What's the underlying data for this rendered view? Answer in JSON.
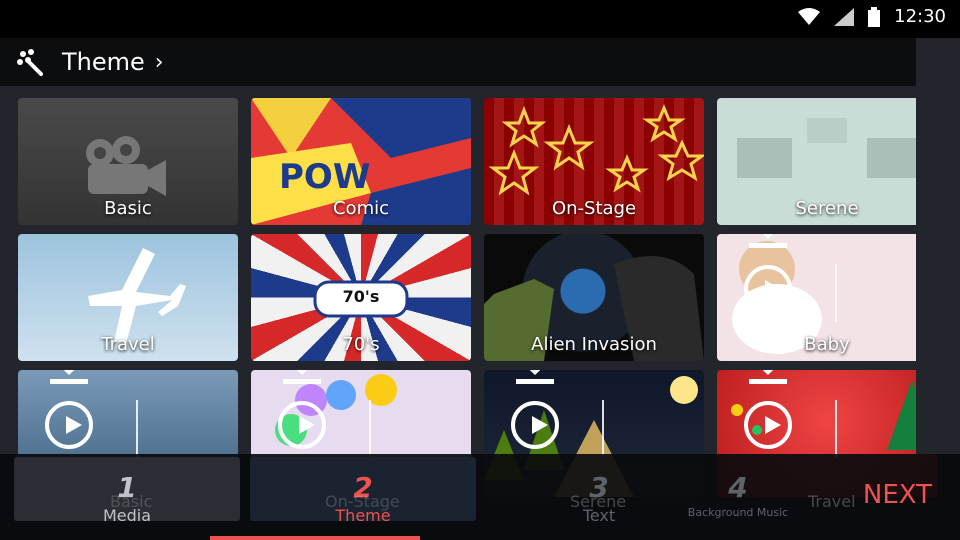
{
  "status_bar": {
    "time": "12:30"
  },
  "header": {
    "title": "Theme",
    "icon": "magic-wand-icon"
  },
  "themes": [
    {
      "name": "Basic",
      "state": "installed"
    },
    {
      "name": "Comic",
      "state": "installed"
    },
    {
      "name": "On-Stage",
      "state": "installed"
    },
    {
      "name": "Serene",
      "state": "installed"
    },
    {
      "name": "Travel",
      "state": "installed"
    },
    {
      "name": "70's",
      "state": "installed",
      "badge": "70's"
    },
    {
      "name": "Alien Invasion",
      "state": "installed"
    },
    {
      "name": "Baby",
      "state": "download"
    },
    {
      "name": "",
      "state": "download"
    },
    {
      "name": "",
      "state": "download"
    },
    {
      "name": "",
      "state": "download"
    },
    {
      "name": "",
      "state": "download"
    }
  ],
  "steps": [
    {
      "number": "1",
      "label": "Media"
    },
    {
      "number": "2",
      "label": "Theme"
    },
    {
      "number": "3",
      "label": "Text"
    },
    {
      "number": "4",
      "label": "Background Music"
    }
  ],
  "bottom_overlay_labels": [
    "Basic",
    "On-Stage",
    "Serene",
    "Travel"
  ],
  "next_label": "NEXT",
  "colors": {
    "accent": "#ef5350",
    "background": "#22252b"
  }
}
